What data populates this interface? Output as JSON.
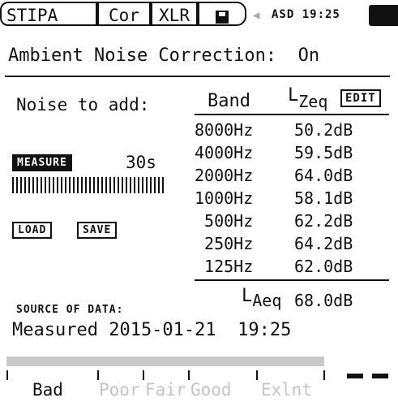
{
  "topbar": {
    "mode_tab": "STIPA",
    "cor_tab": "Cor",
    "xlr_tab": "XLR",
    "save_icon": "floppy-disk-icon",
    "speaker_icon": "speaker-icon",
    "status_text": "ASD 19:25",
    "battery_icon": "battery-icon"
  },
  "title": "Ambient Noise Correction:  On",
  "left": {
    "noise_label": "Noise to add:",
    "measure_button": "MEASURE",
    "duration": "30s",
    "load_button": "LOAD",
    "save_button": "SAVE",
    "source_label": "SOURCE OF DATA:",
    "source_value": "Measured 2015-01-21  19:25"
  },
  "table": {
    "band_header": "Band",
    "leq_header_main": "L",
    "leq_header_sub": "Zeq",
    "edit_button": "EDIT",
    "rows": [
      {
        "band": "8000Hz",
        "value": "50.2dB"
      },
      {
        "band": "4000Hz",
        "value": "59.5dB"
      },
      {
        "band": "2000Hz",
        "value": "64.0dB"
      },
      {
        "band": "1000Hz",
        "value": "58.1dB"
      },
      {
        "band": " 500Hz",
        "value": "62.2dB"
      },
      {
        "band": " 250Hz",
        "value": "64.2dB"
      },
      {
        "band": " 125Hz",
        "value": "62.0dB"
      }
    ],
    "laeq_label_main": "L",
    "laeq_label_sub": "Aeq",
    "laeq_value": "68.0dB"
  },
  "scale": {
    "labels": [
      "Bad",
      "Poor",
      "Fair",
      "Good",
      "Ex",
      "lnt"
    ],
    "active": "Bad",
    "colors": {
      "active": "#111111",
      "inactive": "#c4c4c4"
    }
  }
}
